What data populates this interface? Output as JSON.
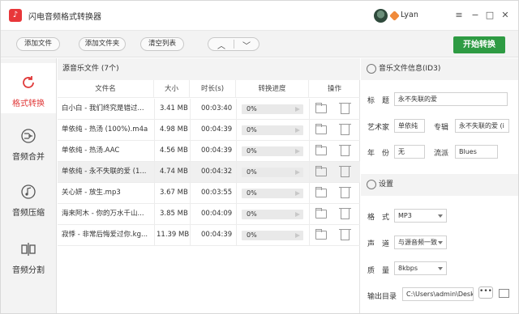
{
  "app": {
    "title": "闪电音频格式转换器",
    "logo_icon": "music-note-icon"
  },
  "user": {
    "name": "Lyan"
  },
  "window_controls": {
    "menu": "≡",
    "minimize": "−",
    "maximize": "□",
    "close": "✕"
  },
  "toolbar": {
    "add_file": "添加文件",
    "add_folder": "添加文件夹",
    "clear_list": "清空列表",
    "up": "︿",
    "down": "﹀",
    "start": "开始转换"
  },
  "sidebar": {
    "items": [
      {
        "label": "格式转换",
        "icon": "refresh-icon",
        "active": true
      },
      {
        "label": "音频合并",
        "icon": "merge-icon",
        "active": false
      },
      {
        "label": "音频压缩",
        "icon": "music-note-icon",
        "active": false
      },
      {
        "label": "音频分割",
        "icon": "split-icon",
        "active": false
      }
    ]
  },
  "file_list": {
    "title": "源音乐文件 (7个)",
    "columns": [
      "文件名",
      "大小",
      "时长(s)",
      "转换进度",
      "操作"
    ],
    "rows": [
      {
        "name": "白小白 - 我们终究是错过...",
        "size": "3.41 MB",
        "duration": "00:03:40",
        "progress": "0%"
      },
      {
        "name": "单依纯 - 热汤 (100%).m4a",
        "size": "4.98 MB",
        "duration": "00:04:39",
        "progress": "0%"
      },
      {
        "name": "单依纯 - 热汤.AAC",
        "size": "4.56 MB",
        "duration": "00:04:39",
        "progress": "0%"
      },
      {
        "name": "单依纯 - 永不失联的爱 (1...",
        "size": "4.74 MB",
        "duration": "00:04:32",
        "progress": "0%"
      },
      {
        "name": "关心妍 - 放生.mp3",
        "size": "3.67 MB",
        "duration": "00:03:55",
        "progress": "0%"
      },
      {
        "name": "海来阿木 - 你的万水千山...",
        "size": "3.85 MB",
        "duration": "00:04:09",
        "progress": "0%"
      },
      {
        "name": "寂悸 - 非常后悔爱过你.kg...",
        "size": "11.39 MB",
        "duration": "00:04:39",
        "progress": "0%"
      }
    ]
  },
  "info": {
    "header": "音乐文件信息(ID3)",
    "title_label": "标　题",
    "title_value": "永不失联的爱",
    "artist_label": "艺术家",
    "artist_value": "单依纯",
    "album_label": "专辑",
    "album_value": "永不失联的爱 (i",
    "year_label": "年　份",
    "year_value": "无",
    "genre_label": "流派",
    "genre_value": "Blues"
  },
  "settings": {
    "header": "设置",
    "format_label": "格　式",
    "format_value": "MP3",
    "channel_label": "声　道",
    "channel_value": "与源音频一致",
    "quality_label": "质　量",
    "quality_value": "8kbps",
    "output_label": "输出目录",
    "output_value": "C:\\Users\\admin\\Deskto",
    "dots": "•••"
  },
  "colors": {
    "accent_green": "#2e9b43",
    "active_red": "#e03a3a"
  }
}
